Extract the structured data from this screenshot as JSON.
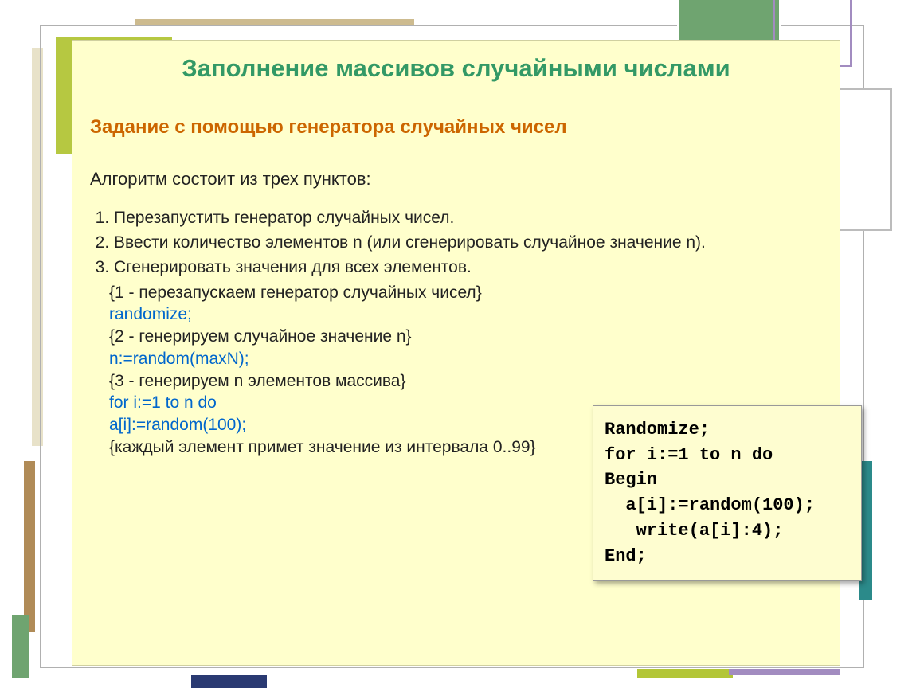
{
  "title": "Заполнение массивов случайными числами",
  "subtitle": "Задание с помощью генератора случайных чисел",
  "intro": "Алгоритм состоит из трех пунктов:",
  "steps": {
    "s1": "Перезапустить генератор случайных чисел.",
    "s2": "Ввести количество элементов n (или сгенерировать случайное значение n).",
    "s3": "Сгенерировать значения для всех элементов."
  },
  "explain": {
    "c1": "{1 - перезапускаем генератор случайных чисел}",
    "l1": "randomize;",
    "c2": "{2 - генерируем случайное значение n}",
    "l2": "n:=random(maxN);",
    "c3": "{3 - генерируем n элементов массива}",
    "l3": "for i:=1 to n do",
    "l4": "a[i]:=random(100);",
    "c4": "{каждый элемент примет значение из интервала 0..99}"
  },
  "codebox": "Randomize;\nfor i:=1 to n do\nBegin\n  a[i]:=random(100);\n   write(a[i]:4);\nEnd;"
}
